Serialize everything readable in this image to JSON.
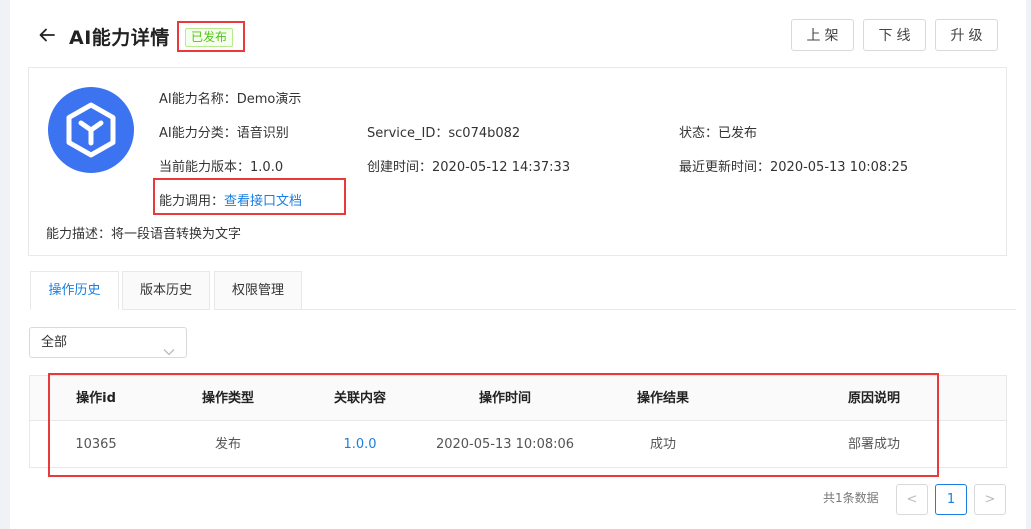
{
  "header": {
    "title": "AI能力详情",
    "status_badge": "已发布",
    "buttons": {
      "up": "上架",
      "down": "下线",
      "upgrade": "升级"
    }
  },
  "info": {
    "name": {
      "label": "AI能力名称：",
      "value": "Demo演示"
    },
    "category": {
      "label": "AI能力分类：",
      "value": "语音识别"
    },
    "service_id": {
      "label": "Service_ID：",
      "value": "sc074b082"
    },
    "status": {
      "label": "状态：",
      "value": "已发布"
    },
    "version": {
      "label": "当前能力版本：",
      "value": "1.0.0"
    },
    "created": {
      "label": "创建时间：",
      "value": "2020-05-12 14:37:33"
    },
    "updated": {
      "label": "最近更新时间：",
      "value": "2020-05-13 10:08:25"
    },
    "call": {
      "label": "能力调用：",
      "link": "查看接口文档"
    },
    "description": {
      "label": "能力描述：",
      "value": "将一段语音转换为文字"
    }
  },
  "tabs": [
    {
      "label": "操作历史",
      "active": true
    },
    {
      "label": "版本历史",
      "active": false
    },
    {
      "label": "权限管理",
      "active": false
    }
  ],
  "filter": {
    "selected": "全部"
  },
  "table": {
    "columns": [
      "操作id",
      "操作类型",
      "关联内容",
      "操作时间",
      "操作结果",
      "原因说明"
    ],
    "rows": [
      [
        "10365",
        "发布",
        "1.0.0",
        "2020-05-13 10:08:06",
        "成功",
        "部署成功"
      ]
    ]
  },
  "pagination": {
    "total_text": "共1条数据",
    "current_page": "1",
    "prev": "<",
    "next": ">"
  },
  "colors": {
    "accent": "#1a7fe0",
    "success": "#52c41a",
    "highlight": "#e83a3a",
    "logo_bg": "#3b73f0"
  }
}
